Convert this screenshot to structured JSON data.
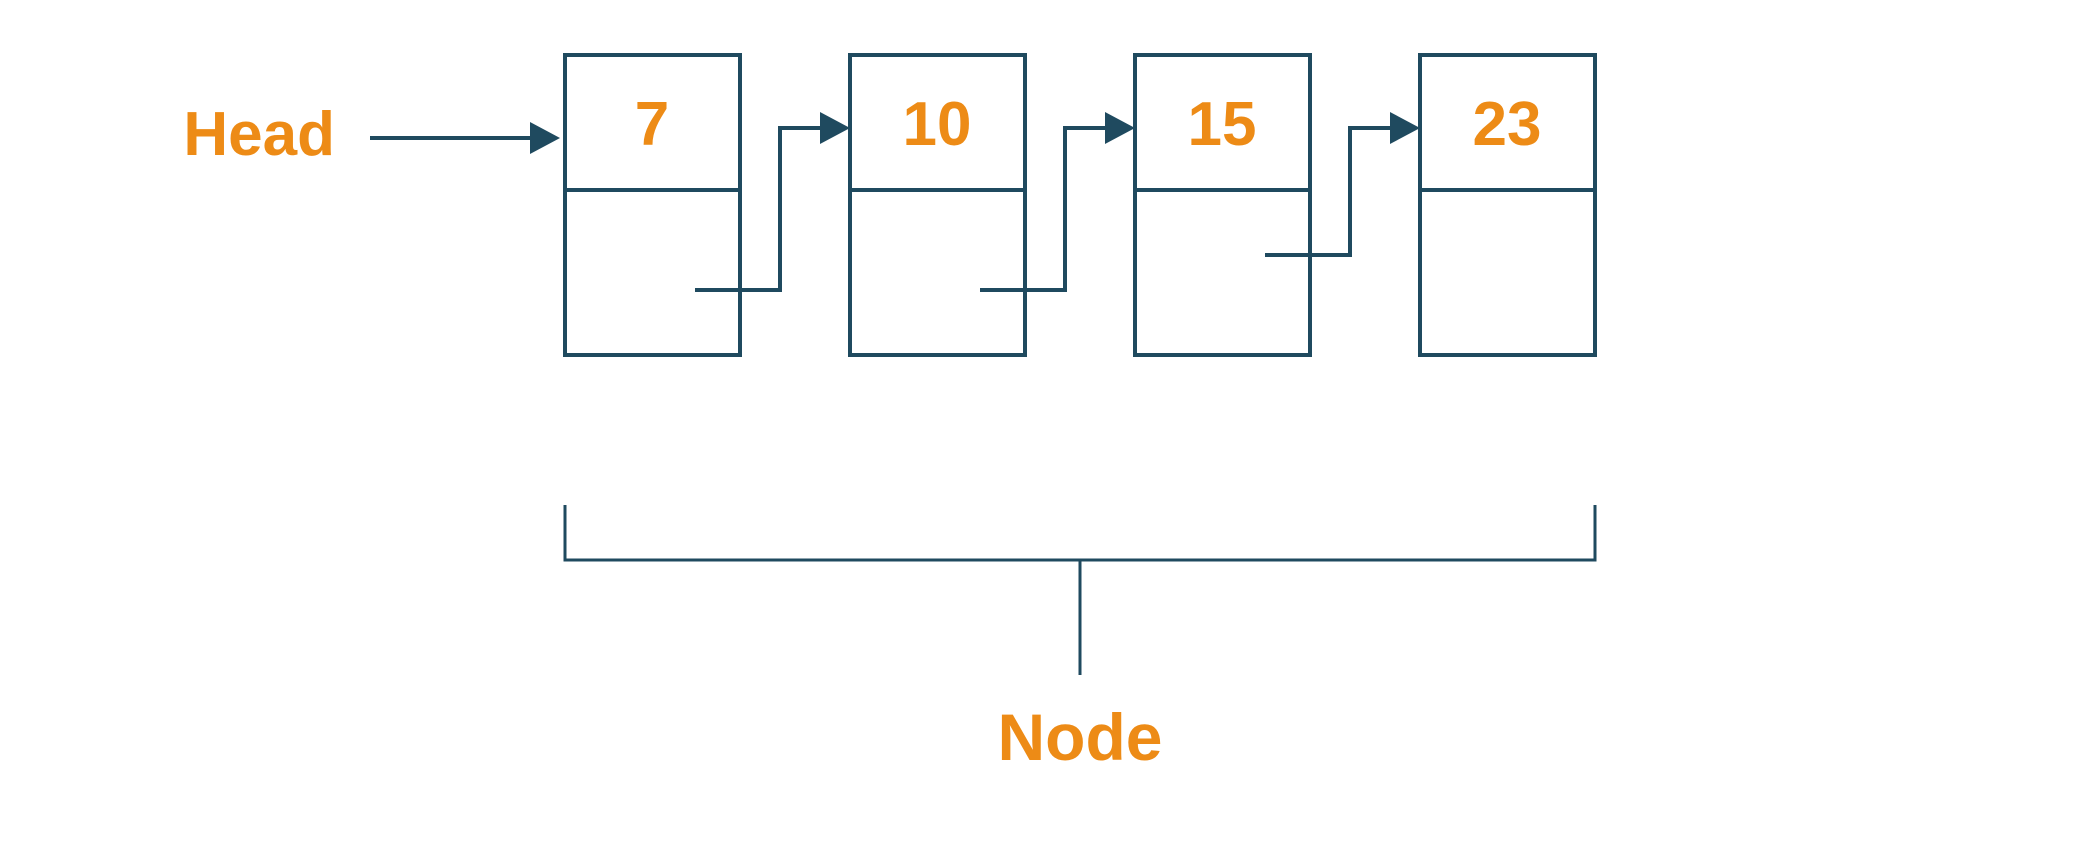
{
  "labels": {
    "head": "Head",
    "node": "Node"
  },
  "nodes": {
    "n0": "7",
    "n1": "10",
    "n2": "15",
    "n3": "23"
  },
  "colors": {
    "accent": "#ed8b16",
    "stroke": "#1f4a5f",
    "background": "#ffffff"
  }
}
